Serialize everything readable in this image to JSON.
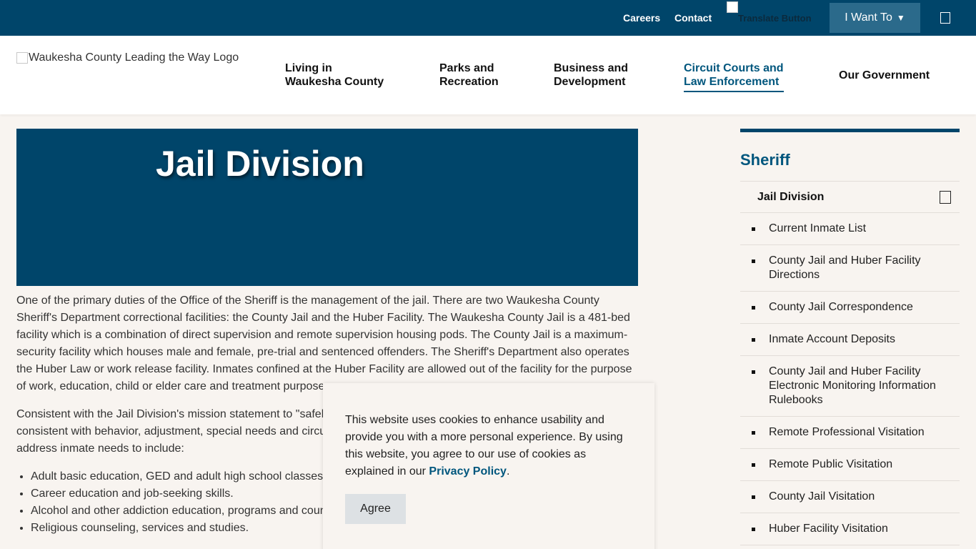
{
  "topbar": {
    "links": [
      "Careers",
      "Contact"
    ],
    "translate_alt": "Translate Button",
    "i_want_to": "I Want To",
    "i_want_to_arrow": "▼"
  },
  "header": {
    "logo_alt": "Waukesha County Leading the Way Logo",
    "nav": [
      {
        "line1": "Living in",
        "line2": "Waukesha County"
      },
      {
        "line1": "Parks and",
        "line2": "Recreation"
      },
      {
        "line1": "Business and",
        "line2": "Development"
      },
      {
        "line1": "Circuit Courts and",
        "line2": "Law Enforcement"
      },
      {
        "line1": "Our Government",
        "line2": ""
      }
    ],
    "active_nav_index": 3
  },
  "hero": {
    "title": "Jail Division"
  },
  "content": {
    "p1": "One of the primary duties of the Office of the Sheriff is the management of the jail. There are two Waukesha County Sheriff's Department correctional facilities: the County Jail and the Huber Facility. The Waukesha County Jail is a 481-bed facility which is a combination of direct supervision and remote supervision housing pods. The County Jail is a maximum-security facility which houses male and female, pre-trial and sentenced offenders. The Sheriff's Department also operates the Huber Law or work release facility. Inmates confined at the Huber Facility are allowed out of the facility for the purpose of work, education, child or elder care and treatment purposes.",
    "p2": "Consistent with the Jail Division's mission statement to \"safely and securely hold inmates in a humane environment consistent with behavior, adjustment, special needs and circumstances\", the Jail Division offers special programming to address inmate needs to include:",
    "list": [
      "Adult basic education, GED and adult high school classes.",
      "Career education and job-seeking skills.",
      "Alcohol and other addiction education, programs and counseling.",
      "Religious counseling, services and studies."
    ]
  },
  "sidebar": {
    "heading": "Sheriff",
    "current": "Jail Division",
    "items": [
      "Current Inmate List",
      "County Jail and Huber Facility Directions",
      "County Jail Correspondence",
      "Inmate Account Deposits",
      "County Jail and Huber Facility Electronic Monitoring Information Rulebooks",
      "Remote Professional Visitation",
      "Remote Public Visitation",
      "County Jail Visitation",
      "Huber Facility Visitation"
    ]
  },
  "cookie": {
    "message": "This website uses cookies to enhance usability and provide you with a more personal experience. By using this website, you agree to our use of cookies as explained in our",
    "link": "Privacy Policy",
    "after": ".",
    "agree": "Agree"
  },
  "colors": {
    "brand": "#00456a",
    "accent": "#00567d",
    "background": "#f8f4f0"
  }
}
